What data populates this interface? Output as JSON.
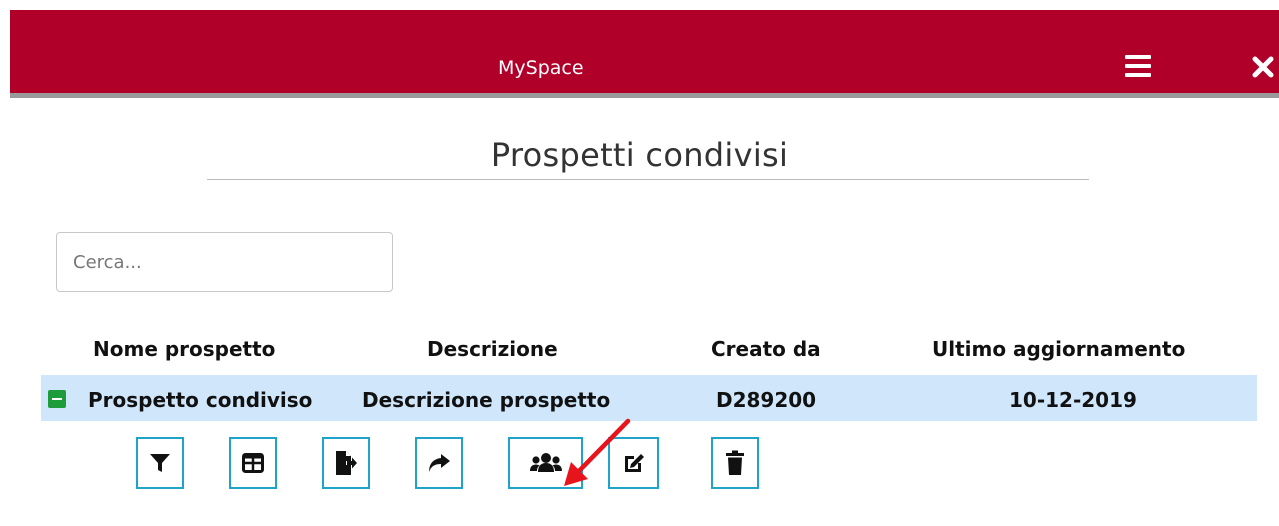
{
  "app": {
    "title": "MySpace"
  },
  "page": {
    "title": "Prospetti condivisi"
  },
  "search": {
    "placeholder": "Cerca...",
    "value": ""
  },
  "table": {
    "headers": [
      "Nome prospetto",
      "Descrizione",
      "Creato da",
      "Ultimo aggiornamento"
    ],
    "rows": [
      [
        "Prospetto condiviso",
        "Descrizione prospetto",
        "D289200",
        "10-12-2019"
      ]
    ]
  },
  "toolbar": {
    "icons": [
      "filter-icon",
      "table-icon",
      "export-icon",
      "share-icon",
      "users-icon",
      "edit-icon",
      "trash-icon"
    ]
  },
  "colors": {
    "header_bg": "#b0002a",
    "row_highlight": "#cfe6fb",
    "button_border": "#1fa3c8",
    "collapse_green": "#1e9b3a",
    "annotation_arrow": "#e8141c"
  }
}
